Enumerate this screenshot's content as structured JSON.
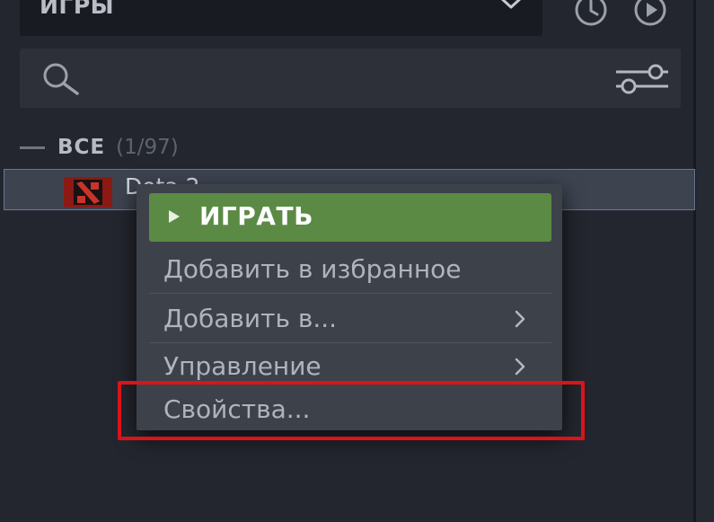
{
  "library": {
    "filter_label": "ИГРЫ",
    "section": {
      "title": "ВСЕ",
      "count": "(1/97)"
    },
    "game": {
      "name": "Dota 2"
    }
  },
  "context_menu": {
    "play": "ИГРАТЬ",
    "add_favorites": "Добавить в избранное",
    "add_to": "Добавить в...",
    "manage": "Управление",
    "properties": "Свойства..."
  },
  "colors": {
    "background": "#23262e",
    "play_button": "#5b8a45",
    "highlight": "#d9141a",
    "selected_row": "#3d4450"
  },
  "icons": [
    "chevron-down-icon",
    "clock-icon",
    "play-circle-icon",
    "search-icon",
    "filter-sliders-icon",
    "dota-icon",
    "triangle-right-icon",
    "chevron-right-icon"
  ]
}
